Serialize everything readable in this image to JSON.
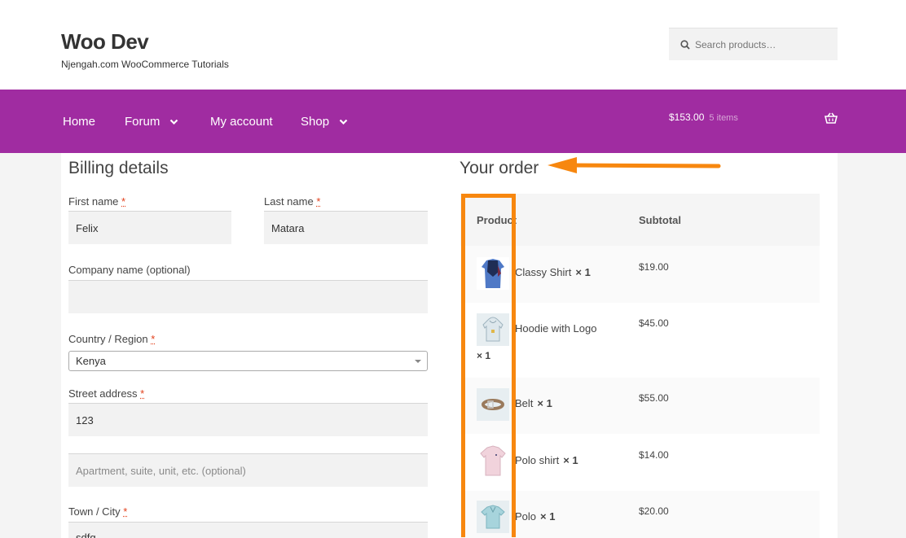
{
  "site": {
    "title": "Woo Dev",
    "description": "Njengah.com WooCommerce Tutorials"
  },
  "search": {
    "placeholder": "Search products…"
  },
  "nav": {
    "items": [
      {
        "label": "Home",
        "has_dropdown": false
      },
      {
        "label": "Forum",
        "has_dropdown": true
      },
      {
        "label": "My account",
        "has_dropdown": false
      },
      {
        "label": "Shop",
        "has_dropdown": true
      }
    ],
    "cart_total": "$153.00",
    "cart_count": "5 items"
  },
  "billing": {
    "title": "Billing details",
    "first_name_label": "First name",
    "first_name_value": "Felix",
    "last_name_label": "Last name",
    "last_name_value": "Matara",
    "company_label": "Company name (optional)",
    "company_value": "",
    "country_label": "Country / Region",
    "country_value": "Kenya",
    "street_label": "Street address",
    "street_value": "123",
    "apartment_placeholder": "Apartment, suite, unit, etc. (optional)",
    "town_label": "Town / City",
    "town_value": "sdfg",
    "required_mark": "*"
  },
  "order": {
    "title": "Your order",
    "col_product": "Product",
    "col_subtotal": "Subtotal",
    "items": [
      {
        "name": "Classy Shirt",
        "qty": "× 1",
        "price": "$19.00",
        "icon": "shirt-icon"
      },
      {
        "name": "Hoodie with Logo",
        "qty": "× 1",
        "price": "$45.00",
        "icon": "hoodie-icon"
      },
      {
        "name": "Belt",
        "qty": "× 1",
        "price": "$55.00",
        "icon": "belt-icon"
      },
      {
        "name": "Polo shirt",
        "qty": "× 1",
        "price": "$14.00",
        "icon": "polo-shirt-icon"
      },
      {
        "name": "Polo",
        "qty": "× 1",
        "price": "$20.00",
        "icon": "polo-icon"
      }
    ]
  },
  "colors": {
    "nav_bg": "#a02ca1",
    "annotation": "#f7870f",
    "required": "#e2401c"
  }
}
